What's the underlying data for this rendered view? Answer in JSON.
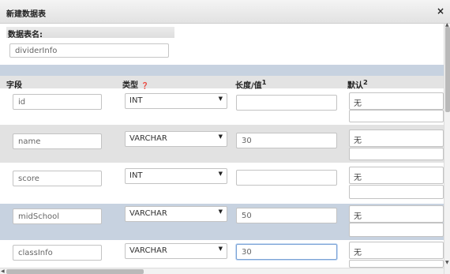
{
  "dialog": {
    "title": "新建数据表",
    "close_icon": "×"
  },
  "table_name": {
    "label": "数据表名:",
    "value": "dividerInfo"
  },
  "columns": {
    "field": "字段",
    "type": "类型",
    "type_help": "❓",
    "length": "长度/值",
    "length_help": "1",
    "default": "默认",
    "default_help": "2"
  },
  "rows": [
    {
      "name": "id",
      "type": "INT",
      "length": "",
      "default": "无"
    },
    {
      "name": "name",
      "type": "VARCHAR",
      "length": "30",
      "default": "无"
    },
    {
      "name": "score",
      "type": "INT",
      "length": "",
      "default": "无"
    },
    {
      "name": "midSchool",
      "type": "VARCHAR",
      "length": "50",
      "default": "无"
    },
    {
      "name": "classInfo",
      "type": "VARCHAR",
      "length": "30",
      "default": "无"
    }
  ],
  "icons": {
    "dropdown_arrow": "▼",
    "scroll_up": "▲",
    "scroll_down": "▼",
    "scroll_left": "◀"
  }
}
